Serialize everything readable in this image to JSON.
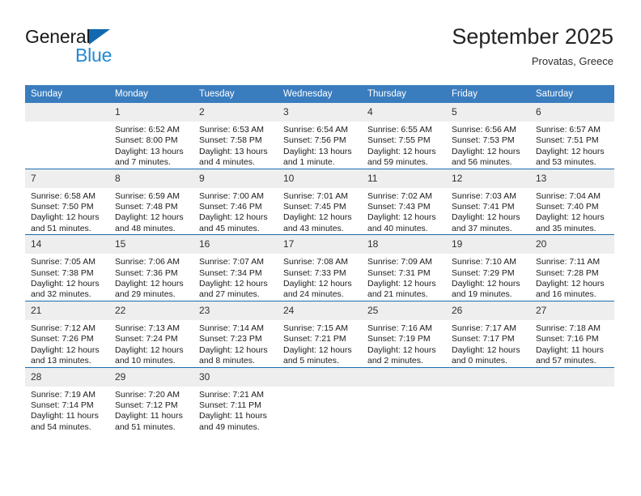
{
  "brand": {
    "name_dark": "General",
    "name_blue": "Blue",
    "triangle_color": "#1269b0",
    "blue_color": "#2389d4"
  },
  "header": {
    "title": "September 2025",
    "location": "Provatas, Greece"
  },
  "colors": {
    "header_row": "#3a7dbf",
    "week_divider": "#1f6cb0",
    "daynum_band": "#eeeeee"
  },
  "weekday_headers": [
    "Sunday",
    "Monday",
    "Tuesday",
    "Wednesday",
    "Thursday",
    "Friday",
    "Saturday"
  ],
  "weeks": [
    [
      {
        "day": "",
        "sunrise": "",
        "sunset": "",
        "daylight1": "",
        "daylight2": "",
        "blank": true
      },
      {
        "day": "1",
        "sunrise": "Sunrise: 6:52 AM",
        "sunset": "Sunset: 8:00 PM",
        "daylight1": "Daylight: 13 hours",
        "daylight2": "and 7 minutes."
      },
      {
        "day": "2",
        "sunrise": "Sunrise: 6:53 AM",
        "sunset": "Sunset: 7:58 PM",
        "daylight1": "Daylight: 13 hours",
        "daylight2": "and 4 minutes."
      },
      {
        "day": "3",
        "sunrise": "Sunrise: 6:54 AM",
        "sunset": "Sunset: 7:56 PM",
        "daylight1": "Daylight: 13 hours",
        "daylight2": "and 1 minute."
      },
      {
        "day": "4",
        "sunrise": "Sunrise: 6:55 AM",
        "sunset": "Sunset: 7:55 PM",
        "daylight1": "Daylight: 12 hours",
        "daylight2": "and 59 minutes."
      },
      {
        "day": "5",
        "sunrise": "Sunrise: 6:56 AM",
        "sunset": "Sunset: 7:53 PM",
        "daylight1": "Daylight: 12 hours",
        "daylight2": "and 56 minutes."
      },
      {
        "day": "6",
        "sunrise": "Sunrise: 6:57 AM",
        "sunset": "Sunset: 7:51 PM",
        "daylight1": "Daylight: 12 hours",
        "daylight2": "and 53 minutes."
      }
    ],
    [
      {
        "day": "7",
        "sunrise": "Sunrise: 6:58 AM",
        "sunset": "Sunset: 7:50 PM",
        "daylight1": "Daylight: 12 hours",
        "daylight2": "and 51 minutes."
      },
      {
        "day": "8",
        "sunrise": "Sunrise: 6:59 AM",
        "sunset": "Sunset: 7:48 PM",
        "daylight1": "Daylight: 12 hours",
        "daylight2": "and 48 minutes."
      },
      {
        "day": "9",
        "sunrise": "Sunrise: 7:00 AM",
        "sunset": "Sunset: 7:46 PM",
        "daylight1": "Daylight: 12 hours",
        "daylight2": "and 45 minutes."
      },
      {
        "day": "10",
        "sunrise": "Sunrise: 7:01 AM",
        "sunset": "Sunset: 7:45 PM",
        "daylight1": "Daylight: 12 hours",
        "daylight2": "and 43 minutes."
      },
      {
        "day": "11",
        "sunrise": "Sunrise: 7:02 AM",
        "sunset": "Sunset: 7:43 PM",
        "daylight1": "Daylight: 12 hours",
        "daylight2": "and 40 minutes."
      },
      {
        "day": "12",
        "sunrise": "Sunrise: 7:03 AM",
        "sunset": "Sunset: 7:41 PM",
        "daylight1": "Daylight: 12 hours",
        "daylight2": "and 37 minutes."
      },
      {
        "day": "13",
        "sunrise": "Sunrise: 7:04 AM",
        "sunset": "Sunset: 7:40 PM",
        "daylight1": "Daylight: 12 hours",
        "daylight2": "and 35 minutes."
      }
    ],
    [
      {
        "day": "14",
        "sunrise": "Sunrise: 7:05 AM",
        "sunset": "Sunset: 7:38 PM",
        "daylight1": "Daylight: 12 hours",
        "daylight2": "and 32 minutes."
      },
      {
        "day": "15",
        "sunrise": "Sunrise: 7:06 AM",
        "sunset": "Sunset: 7:36 PM",
        "daylight1": "Daylight: 12 hours",
        "daylight2": "and 29 minutes."
      },
      {
        "day": "16",
        "sunrise": "Sunrise: 7:07 AM",
        "sunset": "Sunset: 7:34 PM",
        "daylight1": "Daylight: 12 hours",
        "daylight2": "and 27 minutes."
      },
      {
        "day": "17",
        "sunrise": "Sunrise: 7:08 AM",
        "sunset": "Sunset: 7:33 PM",
        "daylight1": "Daylight: 12 hours",
        "daylight2": "and 24 minutes."
      },
      {
        "day": "18",
        "sunrise": "Sunrise: 7:09 AM",
        "sunset": "Sunset: 7:31 PM",
        "daylight1": "Daylight: 12 hours",
        "daylight2": "and 21 minutes."
      },
      {
        "day": "19",
        "sunrise": "Sunrise: 7:10 AM",
        "sunset": "Sunset: 7:29 PM",
        "daylight1": "Daylight: 12 hours",
        "daylight2": "and 19 minutes."
      },
      {
        "day": "20",
        "sunrise": "Sunrise: 7:11 AM",
        "sunset": "Sunset: 7:28 PM",
        "daylight1": "Daylight: 12 hours",
        "daylight2": "and 16 minutes."
      }
    ],
    [
      {
        "day": "21",
        "sunrise": "Sunrise: 7:12 AM",
        "sunset": "Sunset: 7:26 PM",
        "daylight1": "Daylight: 12 hours",
        "daylight2": "and 13 minutes."
      },
      {
        "day": "22",
        "sunrise": "Sunrise: 7:13 AM",
        "sunset": "Sunset: 7:24 PM",
        "daylight1": "Daylight: 12 hours",
        "daylight2": "and 10 minutes."
      },
      {
        "day": "23",
        "sunrise": "Sunrise: 7:14 AM",
        "sunset": "Sunset: 7:23 PM",
        "daylight1": "Daylight: 12 hours",
        "daylight2": "and 8 minutes."
      },
      {
        "day": "24",
        "sunrise": "Sunrise: 7:15 AM",
        "sunset": "Sunset: 7:21 PM",
        "daylight1": "Daylight: 12 hours",
        "daylight2": "and 5 minutes."
      },
      {
        "day": "25",
        "sunrise": "Sunrise: 7:16 AM",
        "sunset": "Sunset: 7:19 PM",
        "daylight1": "Daylight: 12 hours",
        "daylight2": "and 2 minutes."
      },
      {
        "day": "26",
        "sunrise": "Sunrise: 7:17 AM",
        "sunset": "Sunset: 7:17 PM",
        "daylight1": "Daylight: 12 hours",
        "daylight2": "and 0 minutes."
      },
      {
        "day": "27",
        "sunrise": "Sunrise: 7:18 AM",
        "sunset": "Sunset: 7:16 PM",
        "daylight1": "Daylight: 11 hours",
        "daylight2": "and 57 minutes."
      }
    ],
    [
      {
        "day": "28",
        "sunrise": "Sunrise: 7:19 AM",
        "sunset": "Sunset: 7:14 PM",
        "daylight1": "Daylight: 11 hours",
        "daylight2": "and 54 minutes."
      },
      {
        "day": "29",
        "sunrise": "Sunrise: 7:20 AM",
        "sunset": "Sunset: 7:12 PM",
        "daylight1": "Daylight: 11 hours",
        "daylight2": "and 51 minutes."
      },
      {
        "day": "30",
        "sunrise": "Sunrise: 7:21 AM",
        "sunset": "Sunset: 7:11 PM",
        "daylight1": "Daylight: 11 hours",
        "daylight2": "and 49 minutes."
      },
      {
        "day": "",
        "sunrise": "",
        "sunset": "",
        "daylight1": "",
        "daylight2": "",
        "blank": true
      },
      {
        "day": "",
        "sunrise": "",
        "sunset": "",
        "daylight1": "",
        "daylight2": "",
        "blank": true
      },
      {
        "day": "",
        "sunrise": "",
        "sunset": "",
        "daylight1": "",
        "daylight2": "",
        "blank": true
      },
      {
        "day": "",
        "sunrise": "",
        "sunset": "",
        "daylight1": "",
        "daylight2": "",
        "blank": true
      }
    ]
  ]
}
